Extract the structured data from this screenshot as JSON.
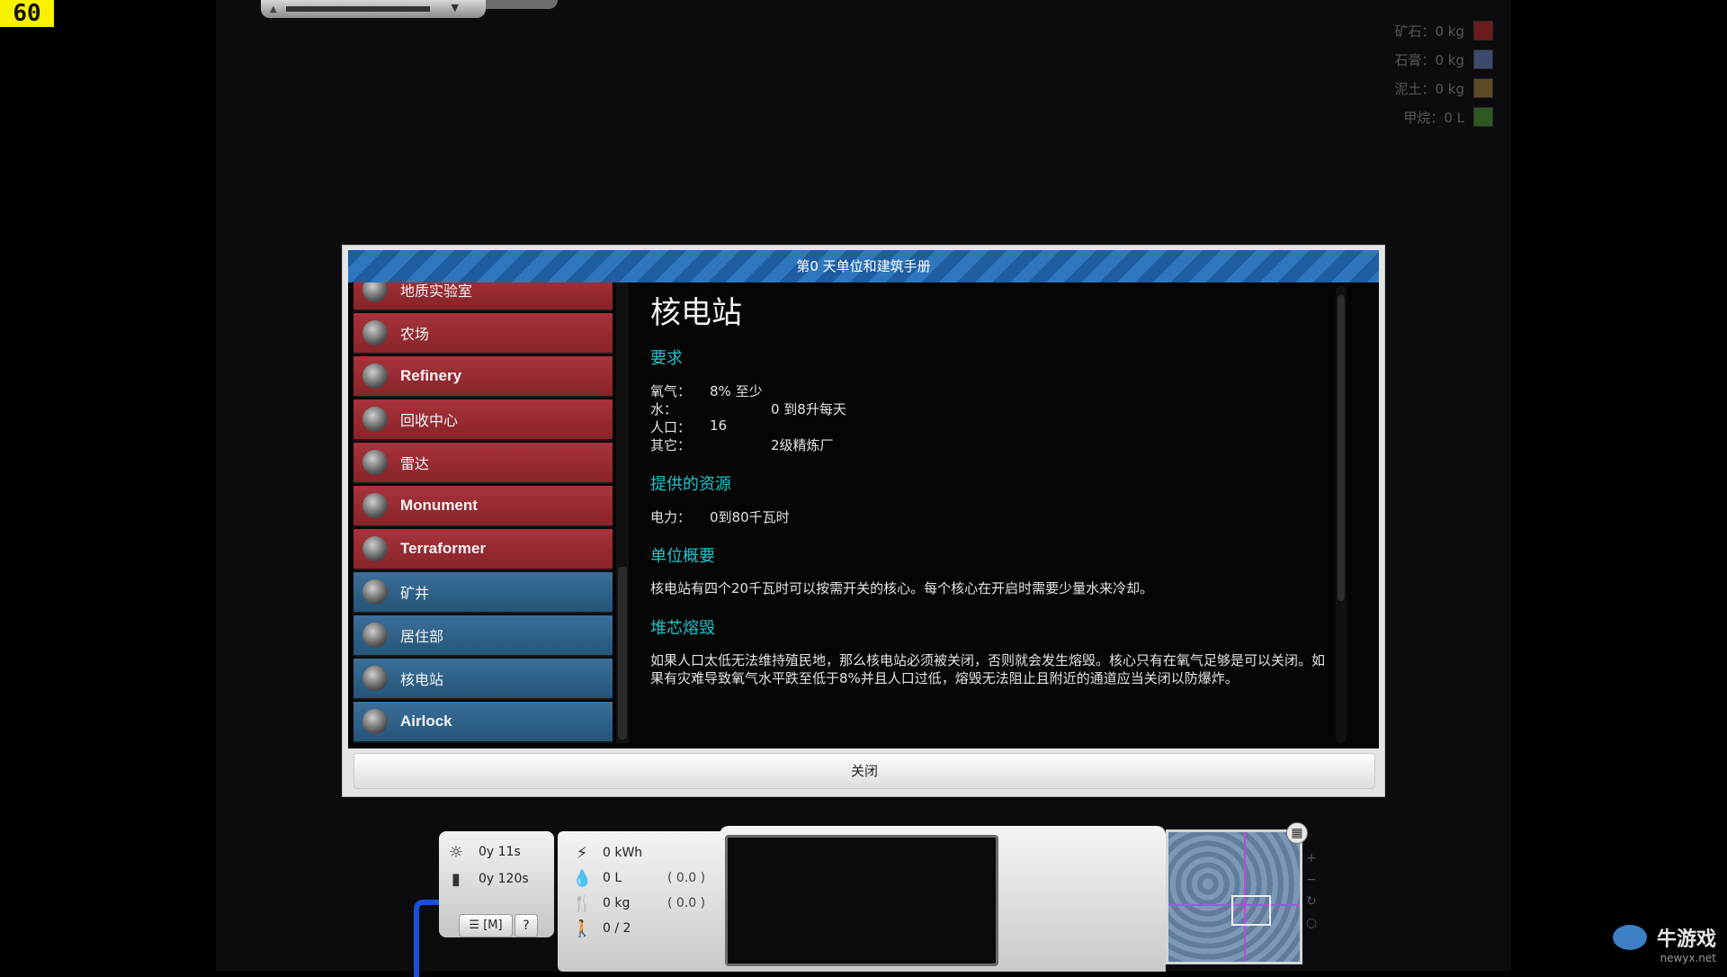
{
  "fps": "60",
  "resources": [
    {
      "text": "矿石：0 kg",
      "icon": "ore-icon",
      "color": "#6b1b1b"
    },
    {
      "text": "石膏：0 kg",
      "icon": "gypsum-icon",
      "color": "#3c4a6e"
    },
    {
      "text": "泥土：0 kg",
      "icon": "dirt-icon",
      "color": "#5e4a22"
    },
    {
      "text": "甲烷：0 L",
      "icon": "methane-icon",
      "color": "#2e5a22"
    }
  ],
  "dialog": {
    "title": "第0 天单位和建筑手册",
    "close_label": "关闭"
  },
  "sidebar": {
    "items": [
      {
        "label": "地质实验室",
        "style": "red",
        "icon": "geology-lab-icon"
      },
      {
        "label": "农场",
        "style": "red",
        "icon": "farm-icon"
      },
      {
        "label": "Refinery",
        "style": "red",
        "icon": "refinery-icon"
      },
      {
        "label": "回收中心",
        "style": "red",
        "icon": "recycling-icon"
      },
      {
        "label": "雷达",
        "style": "red",
        "icon": "radar-icon"
      },
      {
        "label": "Monument",
        "style": "red",
        "icon": "monument-icon"
      },
      {
        "label": "Terraformer",
        "style": "red",
        "icon": "terraformer-icon"
      },
      {
        "label": "矿井",
        "style": "blue",
        "icon": "mine-icon"
      },
      {
        "label": "居住部",
        "style": "blue",
        "icon": "habitat-icon"
      },
      {
        "label": "核电站",
        "style": "blue",
        "icon": "nuclear-icon"
      },
      {
        "label": "Airlock",
        "style": "blue",
        "icon": "airlock-icon"
      }
    ]
  },
  "content": {
    "title": "核电站",
    "requirements_heading": "要求",
    "requirements": [
      {
        "key": "氧气：",
        "value": "8% 至少"
      },
      {
        "key": "水：",
        "value": "0 到8升每天"
      },
      {
        "key": "人口：",
        "value": "16"
      },
      {
        "key": "其它：",
        "value": "2级精炼厂"
      }
    ],
    "resources_heading": "提供的资源",
    "provided": {
      "key": "电力：",
      "value": "0到80千瓦时"
    },
    "overview_heading": "单位概要",
    "overview_text": "核电站有四个20千瓦时可以按需开关的核心。每个核心在开启时需要少量水来冷却。",
    "meltdown_heading": "堆芯熔毁",
    "meltdown_text": "如果人口太低无法维持殖民地，那么核电站必须被关闭，否则就会发生熔毁。核心只有在氧气足够是可以关闭。如果有灾难导致氧气水平跌至低于8%并且人口过低，熔毁无法阻止且附近的通道应当关闭以防爆炸。"
  },
  "hud": {
    "time1": "0y 11s",
    "time2": "0y 120s",
    "menu_label": "☰ [M]",
    "help_label": "?",
    "power": "0 kWh",
    "water": "0 L",
    "water_rate": "( 0.0 )",
    "food": "0 kg",
    "food_rate": "( 0.0 )",
    "population": "0 / 2"
  },
  "watermark": {
    "name": "牛游戏",
    "url": "newyx.net"
  }
}
